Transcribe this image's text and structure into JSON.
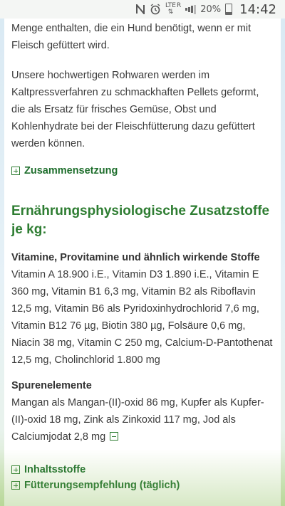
{
  "status_bar": {
    "notification_icon": "n-icon",
    "alarm_icon": "alarm-clock-icon",
    "network_label": "LTE",
    "network_sub": "R",
    "battery_text": "20%",
    "time": "14:42"
  },
  "article": {
    "paragraph1": "Menge enthalten, die ein Hund benötigt, wenn er mit Fleisch gefüttert wird.",
    "paragraph2": "Unsere hochwertigen Rohwaren werden im Kaltpressverfahren zu schmackhaften Pellets geformt, die als Ersatz für frisches Gemüse, Obst und Kohlenhydrate bei der Fleischfütterung dazu gefüttert werden können.",
    "toggle_zusammensetzung": "Zusammensetzung",
    "heading": "Ernährungsphysiologische Zusatzstoffe je kg:",
    "vitamins_title": "Vitamine, Provitamine und ähnlich wirkende Stoffe",
    "vitamins_text": "Vitamin A 18.900 i.E., Vitamin D3 1.890 i.E., Vitamin E 360 mg, Vitamin B1 6,3 mg, Vitamin B2 als Riboflavin 12,5 mg, Vitamin B6 als Pyridoxinhydrochlorid 7,6 mg, Vitamin B12 76 µg, Biotin 380 µg, Folsäure 0,6 mg, Niacin 38 mg, Vitamin C 250 mg, Calcium-D-Pantothenat 12,5 mg, Cholinchlorid 1.800 mg",
    "trace_title": "Spurenelemente",
    "trace_text": "Mangan als Mangan-(II)-oxid 86 mg, Kupfer als Kupfer-(II)-oxid 18 mg, Zink als Zinkoxid 117 mg, Jod als Calciumjodat 2,8 mg",
    "toggle_inhaltsstoffe": "Inhaltsstoffe",
    "toggle_fuetterung": "Fütterungsempfehlung (täglich)"
  },
  "colors": {
    "accent_green": "#2e7d32",
    "text": "#3a3a3a"
  }
}
